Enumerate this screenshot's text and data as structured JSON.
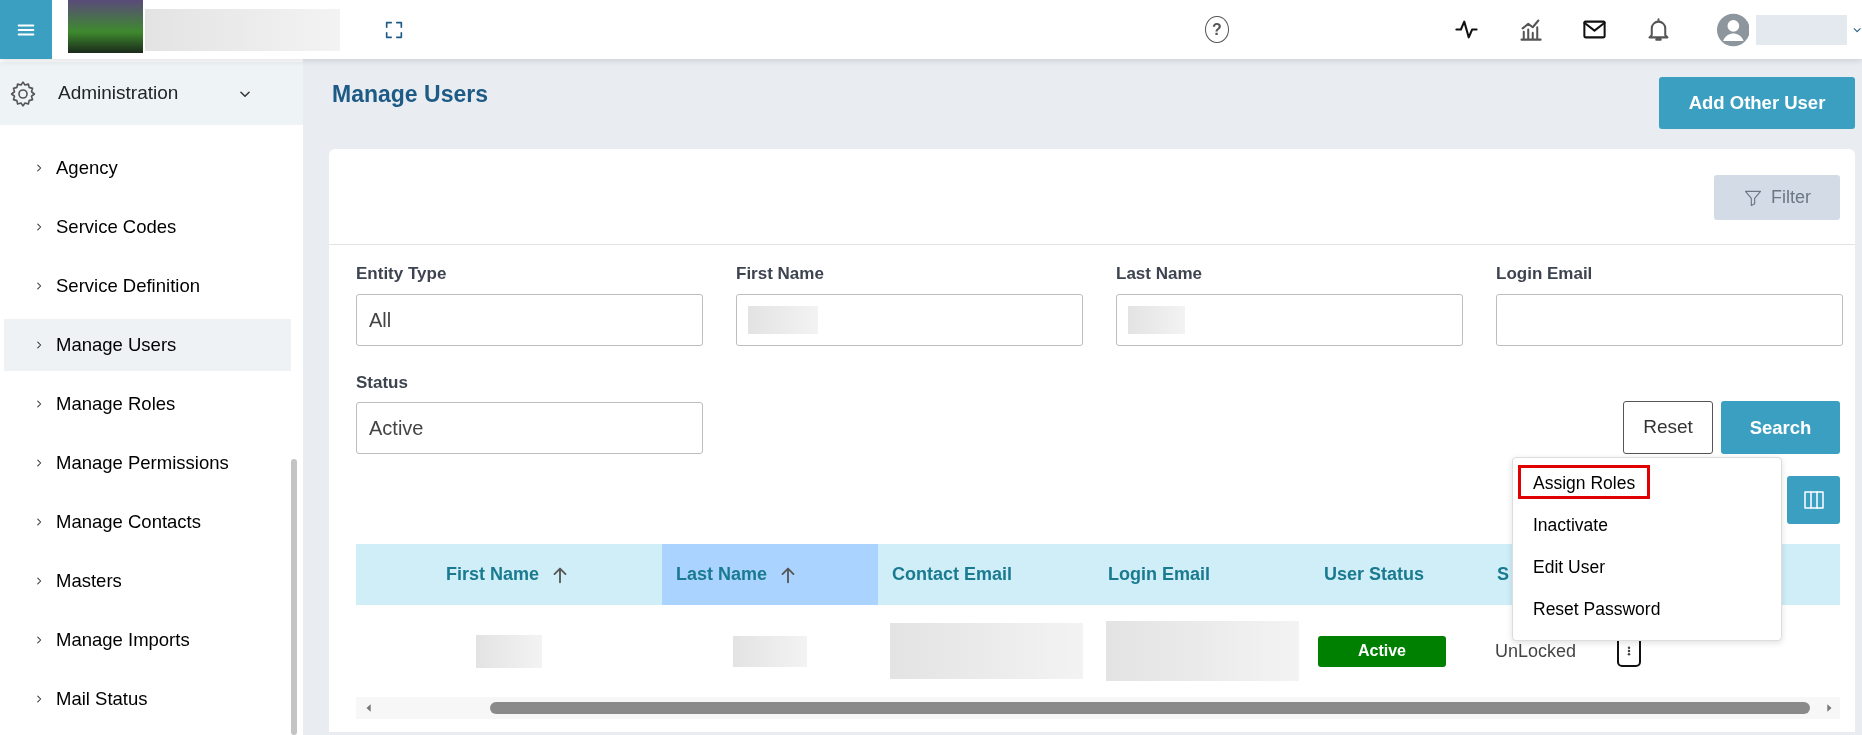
{
  "header": {
    "help_glyph": "?"
  },
  "sidebar": {
    "section": {
      "label": "Administration",
      "expanded": true
    },
    "items": [
      {
        "label": "Agency",
        "selected": false
      },
      {
        "label": "Service Codes",
        "selected": false
      },
      {
        "label": "Service Definition",
        "selected": false
      },
      {
        "label": "Manage Users",
        "selected": true
      },
      {
        "label": "Manage Roles",
        "selected": false
      },
      {
        "label": "Manage Permissions",
        "selected": false
      },
      {
        "label": "Manage Contacts",
        "selected": false
      },
      {
        "label": "Masters",
        "selected": false
      },
      {
        "label": "Manage Imports",
        "selected": false
      },
      {
        "label": "Mail Status",
        "selected": false
      }
    ]
  },
  "page": {
    "title": "Manage Users",
    "add_button": "Add Other User"
  },
  "filter": {
    "button": "Filter",
    "fields": [
      {
        "kind": "select",
        "label": "Entity Type",
        "value": "All"
      },
      {
        "kind": "text",
        "label": "First Name",
        "redacted": true
      },
      {
        "kind": "text",
        "label": "Last Name",
        "redacted": true
      },
      {
        "kind": "text",
        "label": "Login Email",
        "redacted": false
      },
      {
        "kind": "select",
        "label": "Status",
        "value": "Active"
      }
    ],
    "reset_button": "Reset",
    "search_button": "Search"
  },
  "table": {
    "columns": [
      {
        "label": "First Name",
        "sortable": true,
        "selected": false
      },
      {
        "label": "Last Name",
        "sortable": true,
        "selected": true
      },
      {
        "label": "Contact Email",
        "sortable": false,
        "selected": false
      },
      {
        "label": "Login Email",
        "sortable": false,
        "selected": false
      },
      {
        "label": "User Status",
        "sortable": false,
        "selected": false
      },
      {
        "label": "S",
        "selected": false
      }
    ],
    "rows": [
      {
        "user_status": "Active",
        "lock_status": "UnLocked"
      }
    ]
  },
  "action_menu": {
    "items": [
      {
        "label": "Assign Roles",
        "outlined": true
      },
      {
        "label": "Inactivate",
        "outlined": false
      },
      {
        "label": "Edit User",
        "outlined": false
      },
      {
        "label": "Reset Password",
        "outlined": false
      }
    ]
  }
}
